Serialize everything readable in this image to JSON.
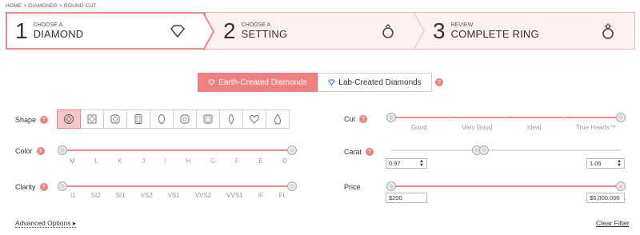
{
  "breadcrumb": "HOME > DIAMONDS > ROUND CUT",
  "steps": [
    {
      "num": "1",
      "small": "CHOOSE A",
      "big": "DIAMOND",
      "icon": "diamond-icon"
    },
    {
      "num": "2",
      "small": "CHOOSE A",
      "big": "SETTING",
      "icon": "ring-setting-icon"
    },
    {
      "num": "3",
      "small": "REVIEW",
      "big": "COMPLETE RING",
      "icon": "complete-ring-icon"
    }
  ],
  "toggle": {
    "earth": "Earth-Created Diamonds",
    "lab": "Lab-Created Diamonds",
    "active": "earth"
  },
  "help": "?",
  "filters": {
    "shape": {
      "label": "Shape",
      "options": [
        "round",
        "princess",
        "cushion",
        "emerald",
        "oval",
        "asscher",
        "radiant",
        "marquise",
        "heart",
        "pear"
      ],
      "selected": "round"
    },
    "color": {
      "label": "Color",
      "ticks": [
        "M",
        "L",
        "K",
        "J",
        "I",
        "H",
        "G",
        "F",
        "E",
        "D"
      ],
      "range": [
        "M",
        "D"
      ]
    },
    "clarity": {
      "label": "Clarity",
      "ticks": [
        "I1",
        "SI2",
        "SI1",
        "VS2",
        "VS1",
        "VVS2",
        "VVS1",
        "IF",
        "FL"
      ],
      "range": [
        "I1",
        "FL"
      ]
    },
    "cut": {
      "label": "Cut",
      "ticks": [
        "Good",
        "Very Good",
        "Ideal",
        "True Hearts™"
      ],
      "range": [
        "Good",
        "True Hearts™"
      ]
    },
    "carat": {
      "label": "Carat",
      "min": "0.97",
      "max": "1.05"
    },
    "price": {
      "label": "Price",
      "min": "$200",
      "max": "$5,000,000"
    }
  },
  "advanced": "Advanced Options ▸",
  "clear": "Clear Filter",
  "colors": {
    "accent": "#f07f7f",
    "accent_light": "#f7c7c7"
  }
}
